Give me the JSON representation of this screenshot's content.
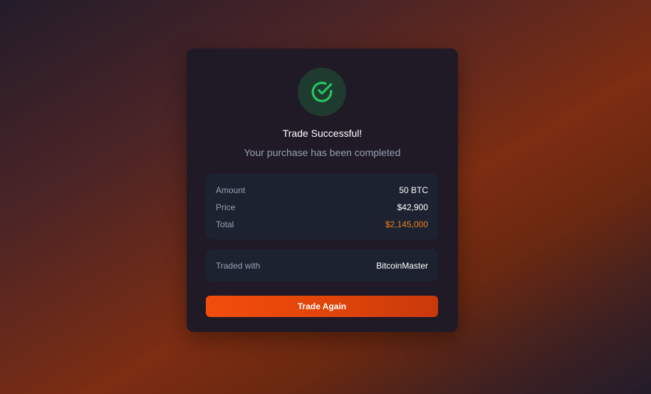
{
  "status": {
    "icon": "check-circle-icon",
    "title": "Trade Successful!",
    "subtitle": "Your purchase has been completed"
  },
  "details": [
    {
      "label": "Amount",
      "value": "50 BTC"
    },
    {
      "label": "Price",
      "value": "$42,900"
    },
    {
      "label": "Total",
      "value": "$2,145,000"
    }
  ],
  "trader": {
    "label": "Traded with",
    "name": "BitcoinMaster"
  },
  "actions": {
    "trade_again_label": "Trade Again"
  },
  "colors": {
    "success": "#22c55e",
    "accent": "#f0801f",
    "button": "#f34d0c"
  }
}
